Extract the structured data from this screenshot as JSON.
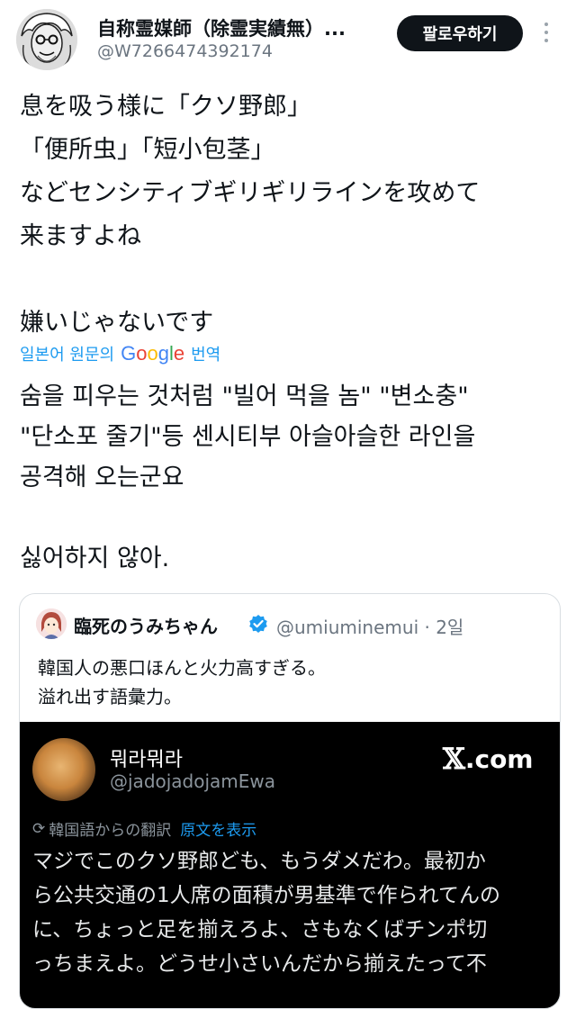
{
  "header": {
    "display_name": "自称霊媒師（除霊実績無）...",
    "handle": "@W7266474392174",
    "follow_label": "팔로우하기",
    "more_icon": "more-vertical-icon"
  },
  "tweet": {
    "text": "息を吸う様に「クソ野郎」\n「便所虫」「短小包茎」\nなどセンシティブギリギリラインを攻めて\n来ますよね\n\n嫌いじゃないです",
    "translate_prefix": "일본어 원문의",
    "translate_brand": "Google",
    "translate_suffix": "번역",
    "translated_text": "숨을 피우는 것처럼 \"빌어 먹을 놈\" \"변소충\"\n\"단소포 줄기\"등 센시티부 아슬아슬한 라인을\n공격해 오는군요\n\n싫어하지 않아."
  },
  "quote": {
    "name": "臨死のうみちゃん",
    "meta": "@umiuminemui · 2일",
    "text": "韓国人の悪口ほんと火力高すぎる。\n溢れ出す語彙力。",
    "embed": {
      "name": "뭐라뭐라",
      "handle": "@jadojadojamEwa",
      "site_mark": "𝕏",
      "site_suffix": ".com",
      "translated_label": "韓国語からの翻訳",
      "show_original": "原文を表示",
      "text": "マジでこのクソ野郎ども、もうダメだわ。最初か\nら公共交通の1人席の面積が男基準で作られてんの\nに、ちょっと足を揃えろよ、さもなくばチンポ切\nっちまえよ。どうせ小さいんだから揃えたって不"
    }
  },
  "colors": {
    "link": "#1d9bf0",
    "muted": "#6b7580",
    "text": "#0f1419",
    "follow_bg": "#0f1419"
  }
}
